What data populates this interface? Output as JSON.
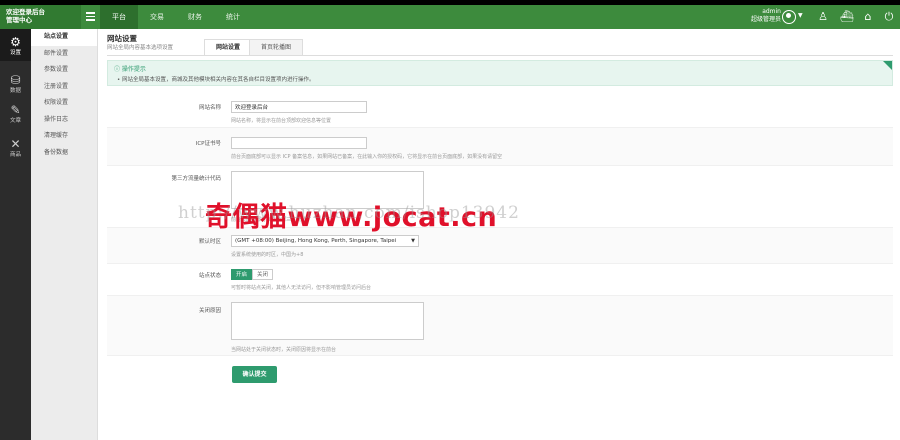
{
  "brand": {
    "line1": "欢迎登录后台",
    "line2": "管理中心"
  },
  "top_nav": [
    "平台",
    "交易",
    "财务",
    "统计"
  ],
  "user": {
    "name": "admin",
    "role": "超级管理员"
  },
  "top_icons": [
    "user-manage-icon",
    "ship-icon",
    "home-icon",
    "power-icon"
  ],
  "rail": [
    {
      "label": "设置",
      "icon": "gear-icon"
    },
    {
      "label": "数据",
      "icon": "database-icon"
    },
    {
      "label": "文章",
      "icon": "pen-icon"
    },
    {
      "label": "商品",
      "icon": "tools-icon"
    }
  ],
  "submenu": [
    "站点设置",
    "邮件设置",
    "参数设置",
    "注册设置",
    "权限设置",
    "操作日志",
    "清理缓存",
    "备份数据"
  ],
  "page": {
    "title": "网站设置",
    "subtitle": "网站全局内容基本选项设置",
    "tabs": [
      "网站设置",
      "首页轮播图"
    ]
  },
  "tip": {
    "title": "操作提示",
    "text": "• 网站全局基本设置，商城及其他模块相关内容在其各自栏目设置项内进行操作。"
  },
  "form": {
    "site_name": {
      "label": "网站名称",
      "value": "欢迎登录后台",
      "hint": "网站名称，将显示在前台顶部欢迎信息等位置"
    },
    "icp": {
      "label": "ICP证书号",
      "value": "",
      "hint": "前台页面底部可以显示 ICP 备案信息，如果网站已备案，在此输入你的授权码，它将显示在前台页面底部，如果没有请留空"
    },
    "stats": {
      "label": "第三方流量统计代码",
      "value": "",
      "hint": "前台页面底部可以显示第三方统计"
    },
    "timezone": {
      "label": "默认时区",
      "value": "(GMT +08:00) Beijing, Hong Kong, Perth, Singapore, Taipei",
      "hint": "设置系统使用的时区，中国为+8"
    },
    "status": {
      "label": "站点状态",
      "on": "开启",
      "off": "关闭",
      "hint": "可暂时将站点关闭，其他人无法访问，但不影响管理员访问后台"
    },
    "close_reason": {
      "label": "关闭原因",
      "value": "",
      "hint": "当网站处于关闭状态时，关闭原因将显示在前台"
    },
    "submit": "确认提交"
  },
  "watermark": {
    "main": "奇偶猫www.jocat.cn",
    "ghost": "http://www.huzhan.com/ishop13942"
  },
  "colors": {
    "header_green": "#3d8b3d",
    "accent": "#2e9b6e",
    "watermark_red": "#e0102a"
  }
}
